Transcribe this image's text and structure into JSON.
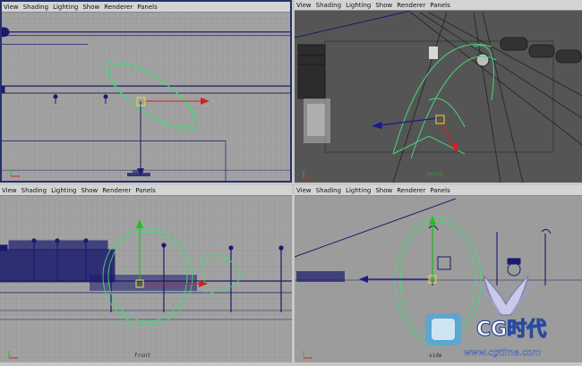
{
  "menu": [
    "View",
    "Shading",
    "Lighting",
    "Show",
    "Renderer",
    "Panels"
  ],
  "viewports": {
    "top": {
      "label": ""
    },
    "persp": {
      "label": "persp"
    },
    "front": {
      "label": "front"
    },
    "side": {
      "label": "side"
    }
  },
  "watermark": {
    "text": "CG时代",
    "url": "www.cgtime.com"
  },
  "colors": {
    "menu_bg": "#d4d4d4",
    "ortho_bg": "#a2a2a2",
    "persp_bg": "#555555",
    "grid": "#8f8f8f",
    "wire_blue": "#1a1a6e",
    "curve_green": "#4ad67a",
    "selection_yellow": "#e8e030",
    "axis_red": "#d42020",
    "axis_green": "#20c020"
  }
}
